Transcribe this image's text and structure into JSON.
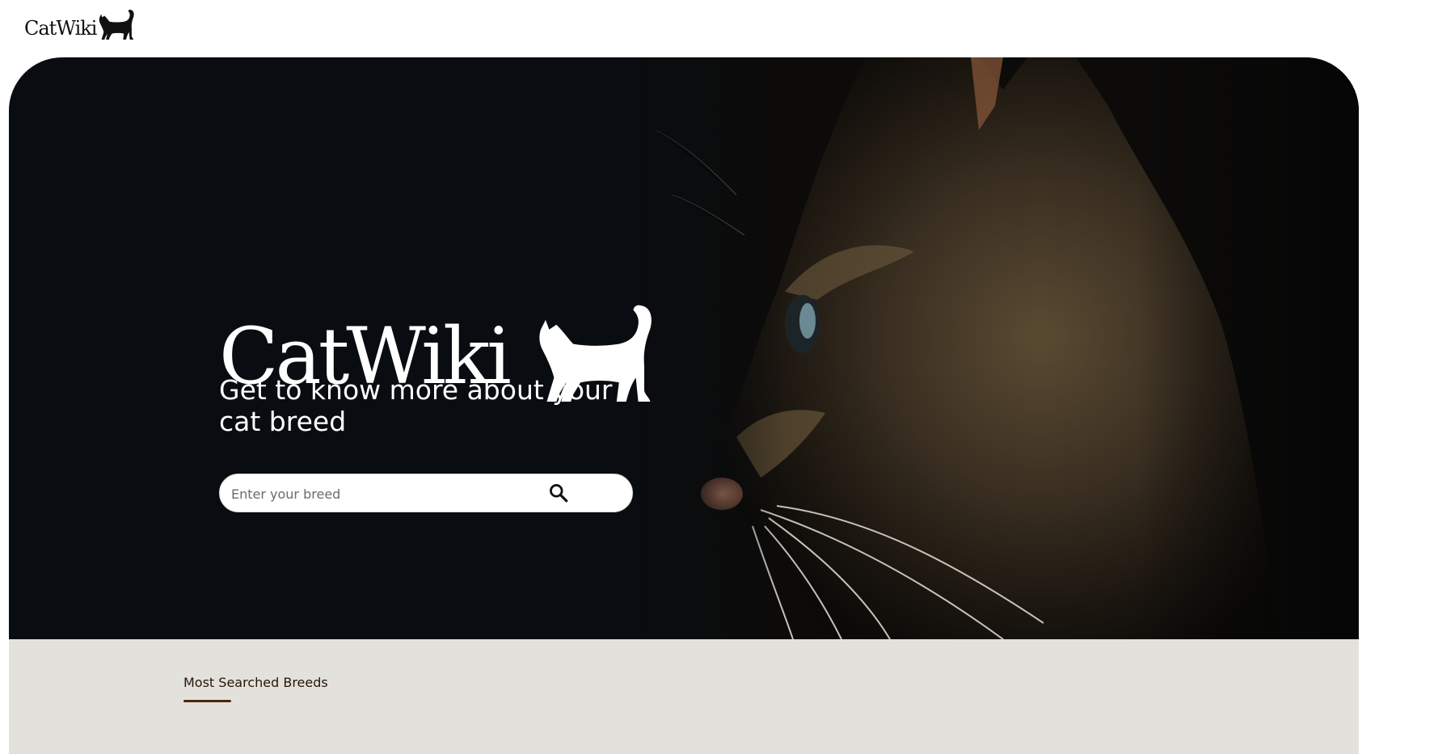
{
  "header": {
    "logo_text": "CatWiki",
    "logo_icon": "cat-silhouette-icon"
  },
  "hero": {
    "logo_text": "CatWiki",
    "logo_icon": "cat-silhouette-icon",
    "tagline": "Get to know more about your cat breed",
    "background_image": "cat-profile-photo",
    "search": {
      "value": "",
      "placeholder": "Enter your breed",
      "button_icon": "search-icon"
    }
  },
  "breeds_section": {
    "label": "Most Searched Breeds",
    "accent_color": "#4d270c"
  },
  "colors": {
    "hero_background": "#090c10",
    "section_background": "#e3e1dc",
    "text_dark": "#291507"
  }
}
